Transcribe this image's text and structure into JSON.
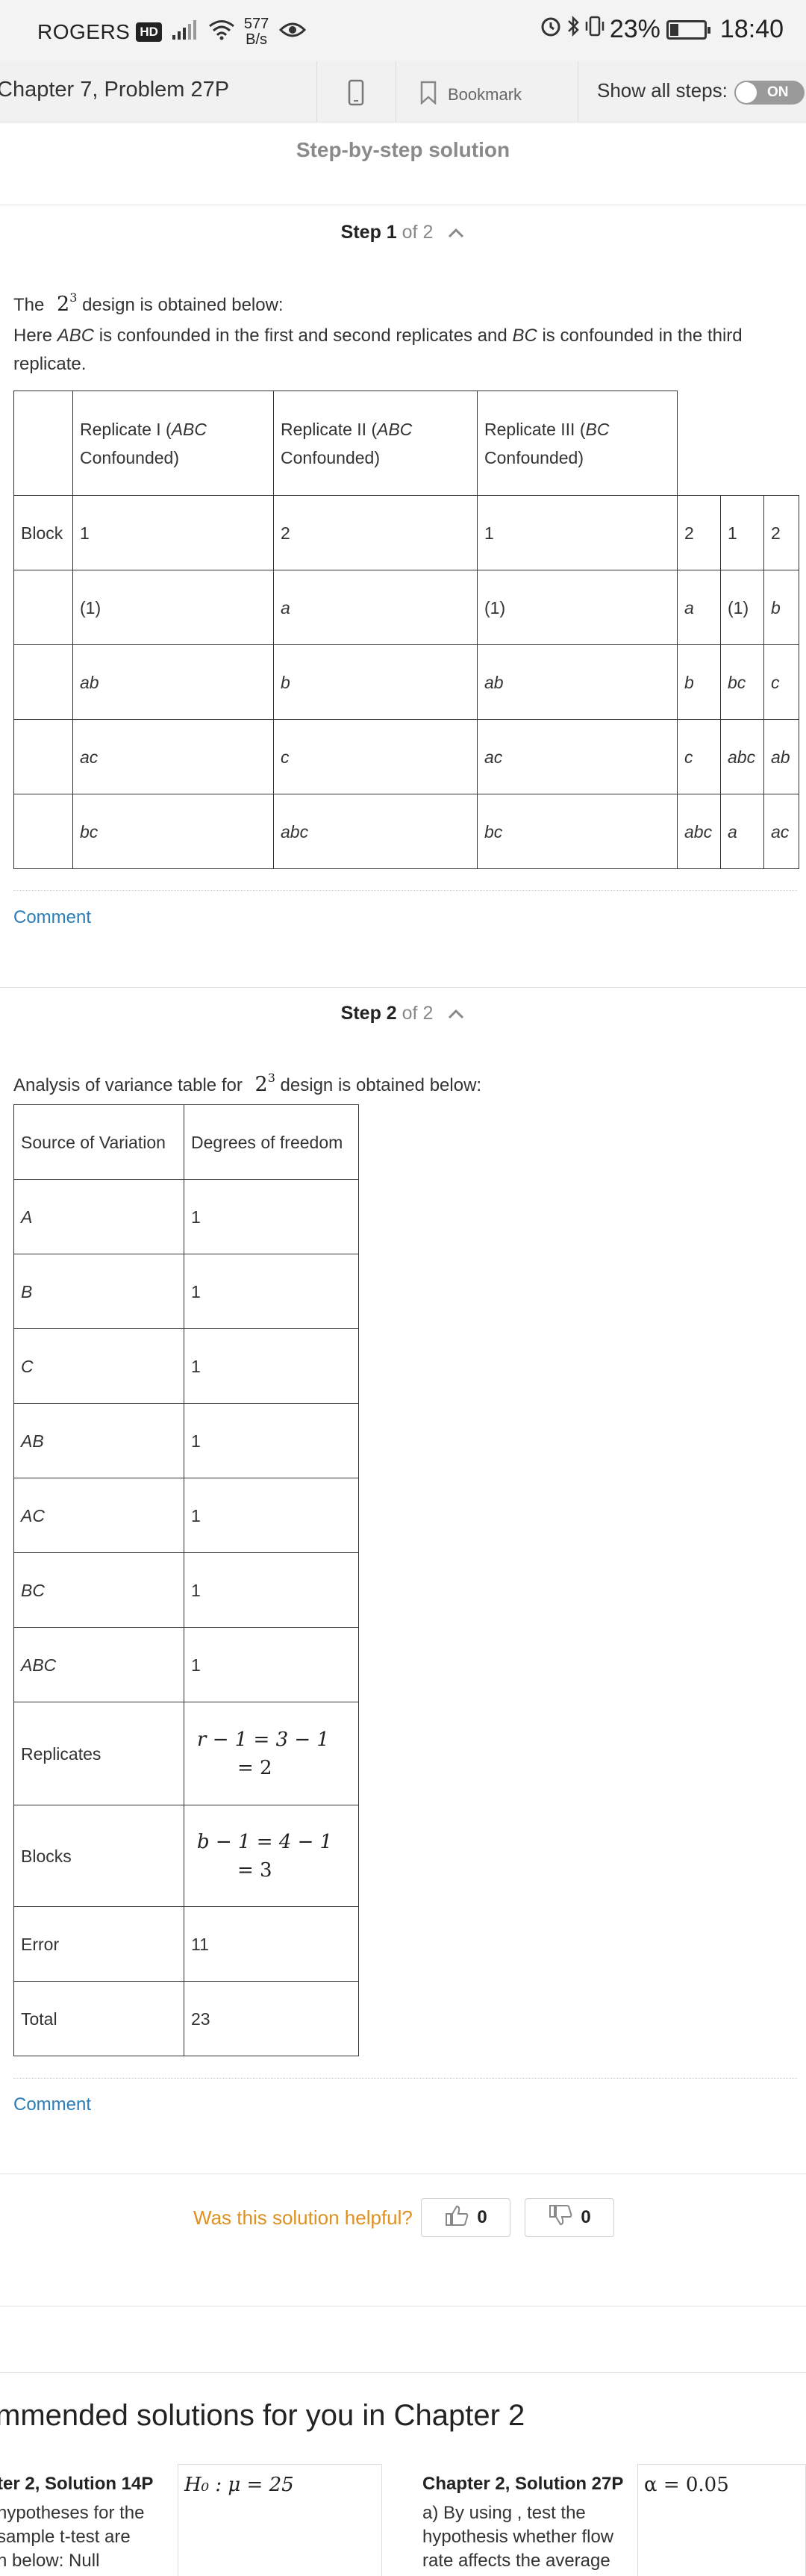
{
  "status_bar": {
    "carrier": "ROGERS",
    "hd_badge": "HD",
    "speed_value": "577",
    "speed_unit": "B/s",
    "battery": "23%",
    "time": "18:40"
  },
  "header": {
    "chapter_title": "Chapter 7, Problem 27P",
    "bookmark_label": "Bookmark",
    "show_steps_label": "Show all steps:",
    "toggle_label": "ON"
  },
  "solution_title": "Step-by-step solution",
  "step1": {
    "label": "Step 1",
    "of": "of 2",
    "intro_before": "The",
    "intro_math_base": "2",
    "intro_math_exp": "3",
    "intro_after": "design is obtained below:",
    "note_1": "Here",
    "note_abc": "ABC",
    "note_2": "is confounded in the first and second replicates and",
    "note_bc": "BC",
    "note_3": "is confounded in the third",
    "note_4": "replicate.",
    "table": {
      "rep1_a": "Replicate I (",
      "rep1_b": "ABC",
      "rep1_c": "Confounded)",
      "rep2_a": "Replicate II (",
      "rep2_b": "ABC",
      "rep2_c": "Confounded)",
      "rep3_a": "Replicate III (",
      "rep3_b": "BC",
      "rep3_c": "Confounded)",
      "rows": [
        [
          "Block",
          "1",
          "2",
          "1",
          "2",
          "1",
          "2"
        ],
        [
          "",
          "(1)",
          "a",
          "(1)",
          "a",
          "(1)",
          "b"
        ],
        [
          "",
          "ab",
          "b",
          "ab",
          "b",
          "bc",
          "c"
        ],
        [
          "",
          "ac",
          "c",
          "ac",
          "c",
          "abc",
          "ab"
        ],
        [
          "",
          "bc",
          "abc",
          "bc",
          "abc",
          "a",
          "ac"
        ]
      ]
    },
    "comment": "Comment"
  },
  "step2": {
    "label": "Step 2",
    "of": "of 2",
    "intro_before": "Analysis of variance table for",
    "intro_math_base": "2",
    "intro_math_exp": "3",
    "intro_after": "design is obtained below:",
    "table": {
      "header": [
        "Source of Variation",
        "Degrees of freedom"
      ],
      "rows": [
        [
          "A",
          "1"
        ],
        [
          "B",
          "1"
        ],
        [
          "C",
          "1"
        ],
        [
          "AB",
          "1"
        ],
        [
          "AC",
          "1"
        ],
        [
          "BC",
          "1"
        ],
        [
          "ABC",
          "1"
        ]
      ],
      "replicates_label": "Replicates",
      "replicates_line1": "r − 1 = 3 − 1",
      "replicates_line2": "= 2",
      "blocks_label": "Blocks",
      "blocks_line1": "b − 1 = 4 − 1",
      "blocks_line2": "= 3",
      "error_label": "Error",
      "error_df": "11",
      "total_label": "Total",
      "total_df": "23"
    },
    "comment": "Comment"
  },
  "feedback": {
    "question": "Was this solution helpful?",
    "up_count": "0",
    "down_count": "0"
  },
  "recommended": {
    "title": "mmended solutions for you in Chapter 2",
    "cards": [
      {
        "title": "ter 2, Solution 14P",
        "lines": [
          "hypotheses for the",
          "sample t-test are",
          "n below: Null"
        ],
        "math": "H₀ : μ = 25"
      },
      {
        "title": "Chapter 2, Solution 27P",
        "lines": [
          "a) By using , test the",
          "hypothesis whether flow",
          "rate affects the average"
        ],
        "math": "α = 0.05"
      }
    ]
  },
  "colors": {
    "link_blue": "#2a7db6",
    "helpful_orange": "#e0901f",
    "header_bg": "#f1f1f1"
  }
}
